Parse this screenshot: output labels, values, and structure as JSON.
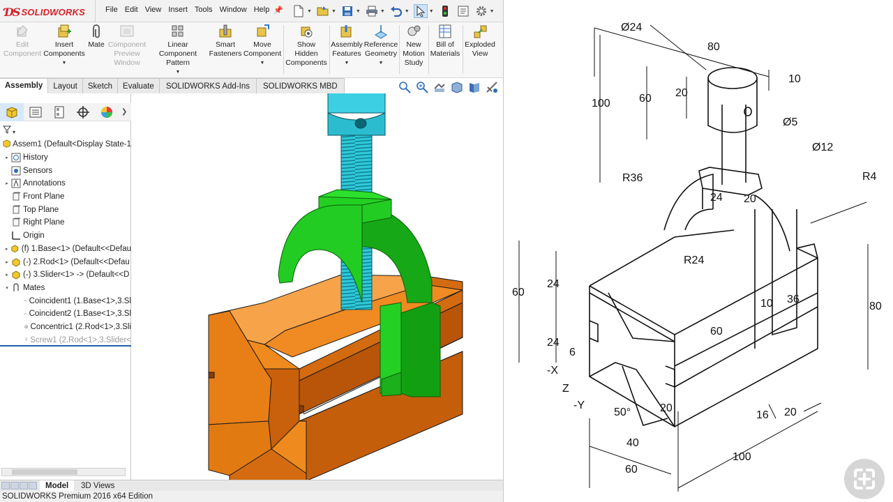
{
  "app": {
    "brand": "SOLIDWORKS",
    "menus": [
      "File",
      "Edit",
      "View",
      "Insert",
      "Tools",
      "Window",
      "Help"
    ]
  },
  "commands": [
    {
      "label": "Edit Component",
      "icon": "edit-component-icon",
      "enabled": false
    },
    {
      "label": "Insert Components",
      "icon": "insert-components-icon",
      "enabled": true
    },
    {
      "label": "Mate",
      "icon": "mate-icon",
      "enabled": true
    },
    {
      "label": "Component Preview Window",
      "icon": "component-preview-icon",
      "enabled": false
    },
    {
      "label": "Linear Component Pattern",
      "icon": "linear-pattern-icon",
      "enabled": true
    },
    {
      "label": "Smart Fasteners",
      "icon": "smart-fasteners-icon",
      "enabled": true
    },
    {
      "label": "Move Component",
      "icon": "move-component-icon",
      "enabled": true
    },
    {
      "label": "Show Hidden Components",
      "icon": "show-hidden-icon",
      "enabled": true
    },
    {
      "label": "Assembly Features",
      "icon": "assembly-features-icon",
      "enabled": true
    },
    {
      "label": "Reference Geometry",
      "icon": "reference-geometry-icon",
      "enabled": true
    },
    {
      "label": "New Motion Study",
      "icon": "motion-study-icon",
      "enabled": true
    },
    {
      "label": "Bill of Materials",
      "icon": "bom-icon",
      "enabled": true
    },
    {
      "label": "Exploded View",
      "icon": "exploded-view-icon",
      "enabled": true
    }
  ],
  "tabs": [
    "Assembly",
    "Layout",
    "Sketch",
    "Evaluate",
    "SOLIDWORKS Add-Ins",
    "SOLIDWORKS MBD"
  ],
  "active_tab": "Assembly",
  "tree": [
    {
      "label": "Assem1  (Default<Display State-1",
      "icon": "assembly-icon",
      "arrow": ""
    },
    {
      "label": "History",
      "icon": "history-icon",
      "arrow": "▸"
    },
    {
      "label": "Sensors",
      "icon": "sensors-icon",
      "arrow": ""
    },
    {
      "label": "Annotations",
      "icon": "annotations-icon",
      "arrow": "▸"
    },
    {
      "label": "Front Plane",
      "icon": "plane-icon",
      "arrow": ""
    },
    {
      "label": "Top Plane",
      "icon": "plane-icon",
      "arrow": ""
    },
    {
      "label": "Right Plane",
      "icon": "plane-icon",
      "arrow": ""
    },
    {
      "label": "Origin",
      "icon": "origin-icon",
      "arrow": ""
    },
    {
      "label": "(f) 1.Base<1>  (Default<<Defau",
      "icon": "part-icon",
      "arrow": "▸"
    },
    {
      "label": "(-) 2.Rod<1>  (Default<<Defau",
      "icon": "part-icon",
      "arrow": "▸"
    },
    {
      "label": "(-) 3.Slider<1>  -> (Default<<D",
      "icon": "part-icon",
      "arrow": "▸"
    },
    {
      "label": "Mates",
      "icon": "mates-icon",
      "arrow": "▾"
    },
    {
      "label": "Coincident1 (1.Base<1>,3.Sl",
      "icon": "coincident-icon",
      "arrow": ""
    },
    {
      "label": "Coincident2 (1.Base<1>,3.Sl",
      "icon": "coincident-icon",
      "arrow": ""
    },
    {
      "label": "Concentric1 (2.Rod<1>,3.Sli",
      "icon": "concentric-icon",
      "arrow": ""
    },
    {
      "label": "Screw1 (2.Rod<1>,3.Slider<",
      "icon": "screw-mate-icon",
      "arrow": "",
      "grey": true
    }
  ],
  "bottom_tabs": [
    "Model",
    "3D Views"
  ],
  "status": "SOLIDWORKS Premium 2016 x64 Edition",
  "drawing": {
    "dims": [
      "Ø24",
      "80",
      "10",
      "20",
      "60",
      "100",
      "Ø5",
      "Ø12",
      "R36",
      "R4",
      "24",
      "20",
      "R24",
      "60",
      "24",
      "10",
      "36",
      "80",
      "60",
      "24",
      "6",
      "-X",
      "Z",
      "-Y",
      "50°",
      "20",
      "16",
      "20",
      "40",
      "100",
      "60"
    ]
  },
  "colors": {
    "base": "#cc6a12",
    "slider": "#18c418",
    "rod": "#35d6e6",
    "brand": "#d3222a"
  }
}
